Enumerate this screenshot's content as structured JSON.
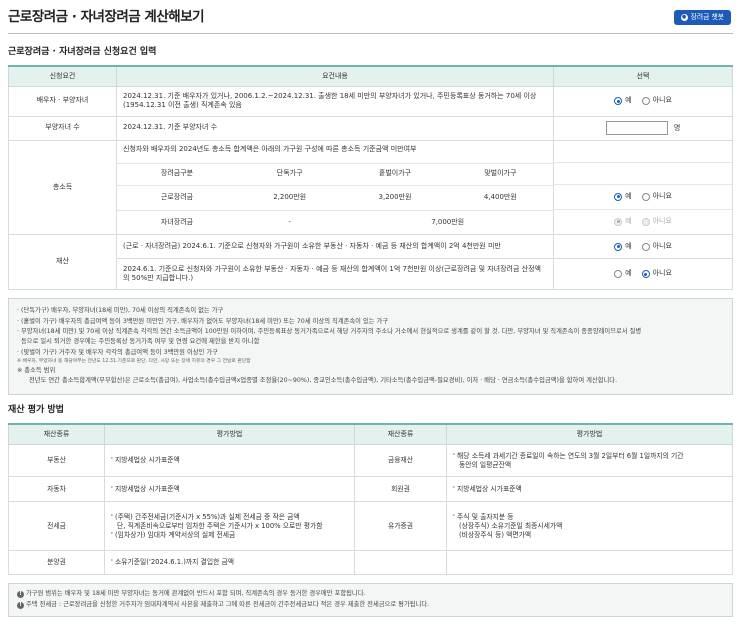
{
  "header": {
    "title": "근로장려금 · 자녀장려금 계산해보기",
    "guide_button": "장려금 챗봇"
  },
  "section1": {
    "title": "근로장려금 · 자녀장려금 신청요건 입력",
    "columns": [
      "신청요건",
      "요건내용",
      "선택"
    ],
    "spouse": {
      "label": "배우자 · 부양자녀",
      "text": "2024.12.31. 기준 배우자가 있거나, 2006.1.2.~2024.12.31. 출생한 18세 미만의 부양자녀가 있거나, 주민등록표상 동거하는 70세 이상(1954.12.31 이전 출생) 직계존속 있음",
      "yes": "예",
      "no": "아니요"
    },
    "dependents": {
      "label": "부양자녀 수",
      "text": "2024.12.31. 기준 부양자녀 수",
      "unit": "명"
    },
    "income": {
      "label": "총소득",
      "text": "신청자와 배우자의 2024년도 총소득 합계액은 아래의 가구원 구성에 따른 총소득 기준금액 미만여부",
      "headers": [
        "장려금구분",
        "단독가구",
        "홑벌이가구",
        "맞벌이가구"
      ],
      "rows": [
        [
          "근로장려금",
          "2,200만원",
          "3,200만원",
          "4,400만원"
        ],
        [
          "자녀장려금",
          "-",
          "7,000만원"
        ]
      ],
      "yes": "예",
      "no": "아니요"
    },
    "property": {
      "label": "재산",
      "text1": "(근로 · 자녀장려금) 2024.6.1. 기준으로 신청자와 가구원이 소유한 부동산 · 자동차 · 예금 등 재산의 합계액이 2억 4천만원 미만",
      "text2": "2024.6.1. 기준으로 신청자와 가구원이 소유한 부동산 · 자동차 · 예금 등 재산의 합계액이 1억 7천만원 이상(근로장려금 및 자녀장려금 산정액의 50%만 지급합니다.)",
      "yes": "예",
      "no": "아니요"
    }
  },
  "notes": {
    "lines": [
      "· (단독가구) 배우자, 부양자녀(18세 미만), 70세 이상의 직계존속이 없는 가구",
      "· (홑벌이 가구) 배우자의 총급여액 등이 3백만원 미만인 가구, 배우자가 없어도 부양자녀(18세 미만) 또는 70세 이상의 직계존속이 있는 가구",
      "· 부양자녀(18세 미만) 및 70세 이상 직계존속 각각의 연간 소득금액이 100만원 이하이며, 주민등록표상 동거가족으로서 해당 거주자의 주소나 거소에서 현실적으로 생계를 같이 할 것. 다만, 부양자녀 및 직계존속이 종종양례이므로서 질병",
      "등으로 일시 퇴거한 경우에는 주민등록상 동거가족 여부 및 연령 요건에 제한을 받지 아니함",
      "· (맞벌이 가구) 거주자 및 배우자 각각의 총급여액 등이 3백만원 이상인 가구"
    ],
    "small": "※ 배우자, 부양자녀 등 해당여부는 전년도 12.31.기준으로 판단. 다만, 사망 또는 장애 치유의 경우 그 전날로 판단함",
    "income_title": "※ 총소득 범위",
    "income_text": "전년도 연간 총소득합계액(부부합산)은 근로소득(총급여), 사업소득(총수입금액x업종별 조정율(20~90%), 종교인소득(총수입금액), 기타소득(총수입금액-필요경비), 이자 · 배당 · 연금소득(총수입금액)을 합하여 계산합니다."
  },
  "section2": {
    "title": "재산 평가 방법",
    "columns": [
      "재산종류",
      "평가방법",
      "재산종류",
      "평가방법"
    ],
    "rows": [
      {
        "k1": "부동산",
        "v1": [
          "' 지방세법상 시가표준액"
        ],
        "k2": "금융재산",
        "v2": [
          "' 해당 소득세 과세기간 종료일이 속하는 연도의 3월 2일부터 6월 1일까지의 기간",
          "동안의 일평균잔액"
        ]
      },
      {
        "k1": "자동차",
        "v1": [
          "' 지방세법상 시가표준액"
        ],
        "k2": "회원권",
        "v2": [
          "' 지방세법상 시가표준액"
        ]
      },
      {
        "k1": "전세금",
        "v1": [
          "' (주택) 간주전세금(기준시가 x 55%)과 실제 전세금 중 작은 금액",
          "단, 직계존비속으로부터 임차한 주택은 기준시가 x 100% 으로만 평가함",
          "' (임차상가) 임대차 계약서상의 실제 전세금"
        ],
        "k2": "유가증권",
        "v2": [
          "' 주식 및 출자지분 등",
          "(상장주식) 소유기준일 최종시세가액",
          "(비상장주식 등) 액면가액"
        ]
      },
      {
        "k1": "분양권",
        "v1": [
          "' 소유기준일('2024.6.1.)까지 결입한 금액"
        ],
        "k2": "",
        "v2": []
      }
    ]
  },
  "footer": {
    "lines": [
      "가구원 범위는 배우자 및 18세 미만 부양자녀는 동거에 관계없이 반드시 포함 되며, 직계존속의 경우 동거한 경우에만 포함됩니다.",
      "주택 전세금 : 근로장려금을 신청한 거주자가 임대차계약서 사본을 제출하고 그에 따른 전세금이 간주전세금보다 적은 경우 제출한 전세금으로 평가됩니다."
    ]
  }
}
